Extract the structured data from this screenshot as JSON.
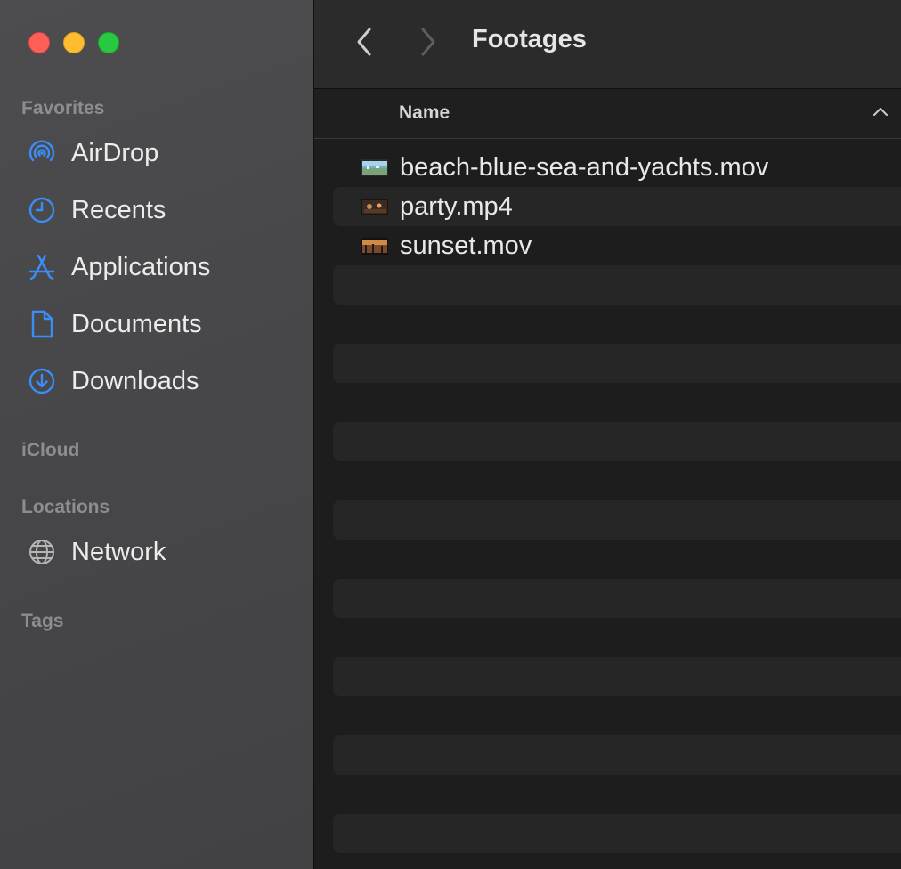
{
  "window": {
    "title": "Footages",
    "controls": [
      "close",
      "minimize",
      "zoom"
    ]
  },
  "sidebar": {
    "sections": {
      "favorites": "Favorites",
      "icloud": "iCloud",
      "locations": "Locations",
      "tags": "Tags"
    },
    "favorites": [
      {
        "label": "AirDrop",
        "icon": "airdrop-icon"
      },
      {
        "label": "Recents",
        "icon": "clock-icon"
      },
      {
        "label": "Applications",
        "icon": "applications-icon"
      },
      {
        "label": "Documents",
        "icon": "document-icon"
      },
      {
        "label": "Downloads",
        "icon": "download-icon"
      }
    ],
    "locations": [
      {
        "label": "Network",
        "icon": "globe-icon"
      }
    ]
  },
  "list": {
    "column_name": "Name",
    "sort": "ascending",
    "files": [
      {
        "name": "beach-blue-sea-and-yachts.mov",
        "icon": "video-thumbnail-icon"
      },
      {
        "name": "party.mp4",
        "icon": "video-thumbnail-icon"
      },
      {
        "name": "sunset.mov",
        "icon": "video-thumbnail-icon"
      }
    ]
  },
  "colors": {
    "accent": "#3b8df7",
    "sidebar_bg": "#4a4a4c",
    "content_bg": "#1d1d1d",
    "stripe": "#262626"
  }
}
